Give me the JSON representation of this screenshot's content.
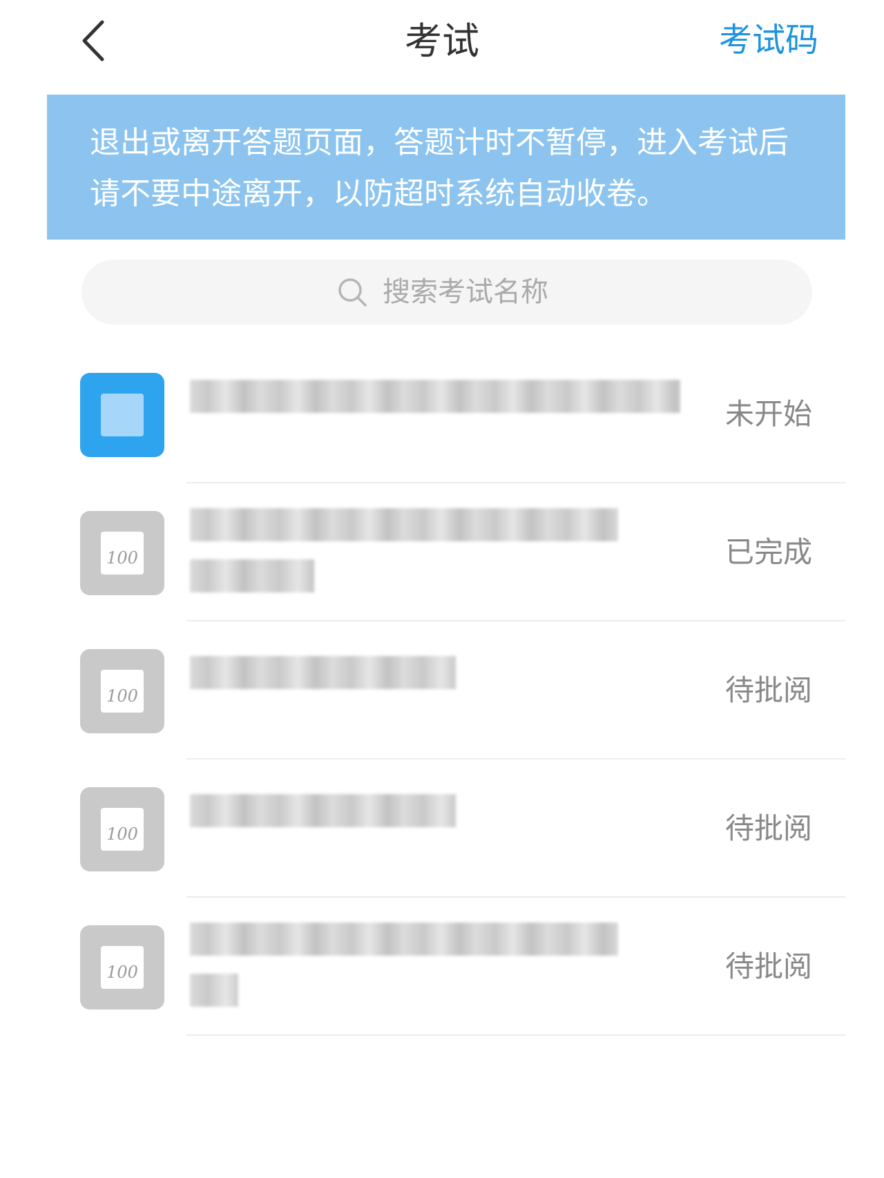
{
  "header": {
    "title": "考试",
    "link_label": "考试码"
  },
  "notice": {
    "text": "退出或离开答题页面，答题计时不暂停，进入考试后请不要中途离开，以防超时系统自动收卷。"
  },
  "search": {
    "placeholder": "搜索考试名称"
  },
  "exams": [
    {
      "status": "未开始",
      "icon_score": "",
      "active": true
    },
    {
      "status": "已完成",
      "icon_score": "100",
      "active": false
    },
    {
      "status": "待批阅",
      "icon_score": "100",
      "active": false
    },
    {
      "status": "待批阅",
      "icon_score": "100",
      "active": false
    },
    {
      "status": "待批阅",
      "icon_score": "100",
      "active": false
    }
  ],
  "colors": {
    "accent": "#1e94e0",
    "notice_bg": "#8cc4ef",
    "active_icon": "#2ea3ee",
    "inactive_icon": "#c9c9c9"
  }
}
